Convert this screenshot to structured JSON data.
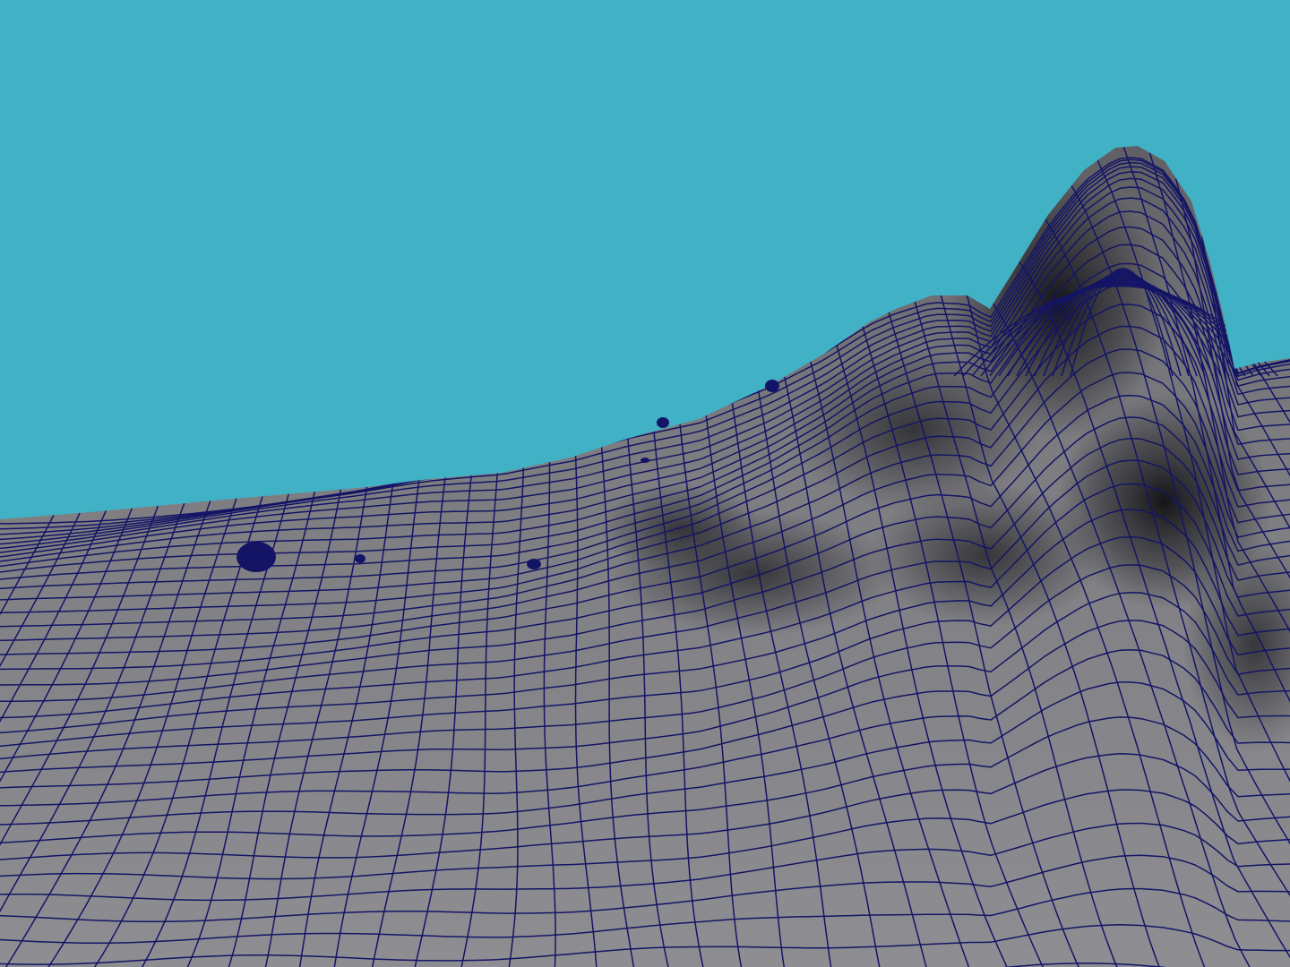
{
  "scene": {
    "kind": "3d-viewport",
    "content": "wireframe-shaded-terrain-mesh",
    "colors": {
      "background": "#41b1c6",
      "surface_light": "#8a8a8e",
      "surface_mid": "#6b6b70",
      "surface_dark": "#1c1c20",
      "wireframe": "#141466"
    }
  }
}
